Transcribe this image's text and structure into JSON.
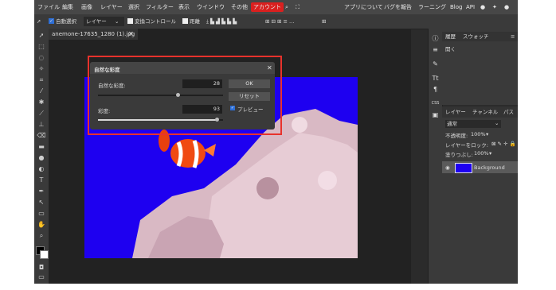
{
  "menu": {
    "items": [
      "ファイル",
      "編集",
      "画像",
      "レイヤー",
      "選択",
      "フィルター",
      "表示",
      "ウインドウ",
      "その他"
    ],
    "account": "アカウント",
    "right_items": [
      "アプリについて",
      "バグを報告",
      "ラーニング",
      "Blog",
      "API"
    ]
  },
  "options": {
    "auto_select": "自動選択",
    "layer_select": "レイヤー",
    "transform_controls": "変換コントロール",
    "distance": "距離"
  },
  "document": {
    "tab_label": "anemone-17635_1280 (1).jpg"
  },
  "dialog": {
    "title": "自然な彩度",
    "vibrance_label": "自然な彩度:",
    "vibrance_value": "28",
    "vibrance_level": 0.64,
    "saturation_label": "彩度:",
    "saturation_value": "93",
    "saturation_level": 0.95,
    "ok_label": "OK",
    "reset_label": "リセット",
    "preview_label": "プレビュー"
  },
  "history_panel": {
    "tabs": [
      "履歴",
      "スウォッチ"
    ],
    "items": [
      "開く"
    ]
  },
  "layers_panel": {
    "tabs": [
      "レイヤー",
      "チャンネル",
      "パス"
    ],
    "blend_mode": "通常",
    "opacity_label": "不透明度:",
    "opacity_value": "100%",
    "lock_label": "レイヤーをロック:",
    "fill_label": "塗りつぶし:",
    "fill_value": "100%",
    "layer_name": "Background"
  },
  "colors": {
    "highlight_red": "#e8322c",
    "account_red": "#d9201f",
    "image_blue": "#1e00f0",
    "accent_blue": "#2e6fd6"
  }
}
